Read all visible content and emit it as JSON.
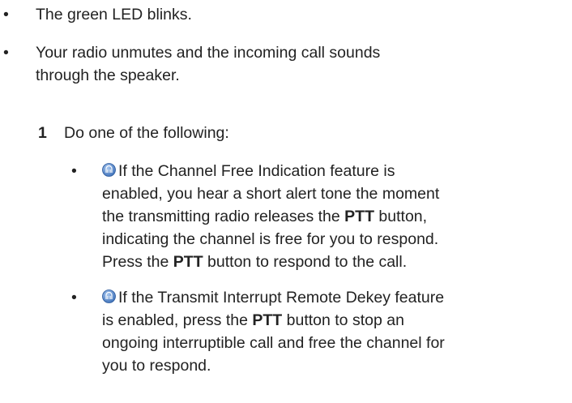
{
  "top_bullets": [
    "The green LED blinks.",
    "Your radio unmutes and the incoming call sounds",
    "through the speaker."
  ],
  "bullet_glyph": "•",
  "step": {
    "number": "1",
    "text": "Do one of the following:"
  },
  "sub1": {
    "l1": "If the Channel Free Indication feature is",
    "l2": "enabled, you hear a short alert tone the moment",
    "l3a": "the transmitting radio releases the ",
    "l3b": "PTT",
    "l3c": " button,",
    "l4": "indicating the channel is free for you to respond.",
    "l5a": "Press the ",
    "l5b": "PTT",
    "l5c": " button to respond to the call."
  },
  "sub2": {
    "l1": "If the Transmit Interrupt Remote Dekey feature",
    "l2a": "is enabled, press the ",
    "l2b": "PTT",
    "l2c": " button to stop an",
    "l3": "ongoing interruptible call and free the channel for",
    "l4": "you to respond."
  },
  "icon": {
    "name": "feature-availability-icon",
    "color": "#4a7fc7"
  }
}
